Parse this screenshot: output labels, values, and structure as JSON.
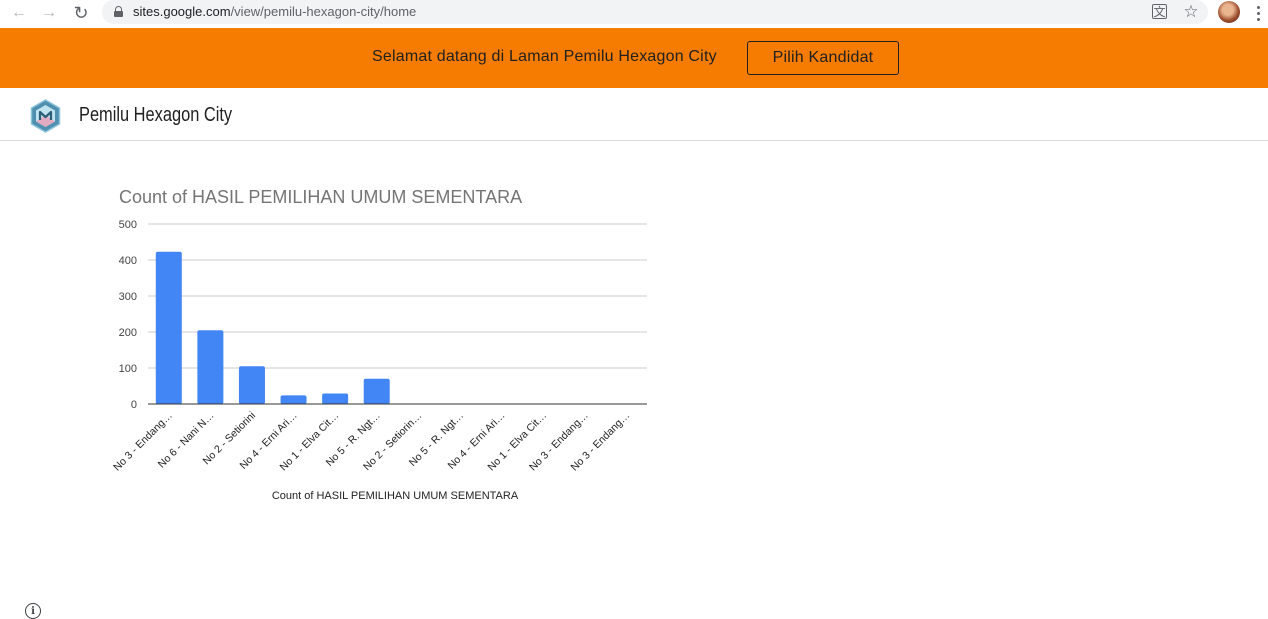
{
  "browser": {
    "url_host": "sites.google.com",
    "url_path": "/view/pemilu-hexagon-city/home",
    "back_icon": "←",
    "forward_icon": "→",
    "reload_icon": "↻",
    "translate_icon": "文",
    "star_icon": "☆"
  },
  "banner": {
    "text": "Selamat datang di Laman Pemilu Hexagon City",
    "button_label": "Pilih Kandidat",
    "color": "#f57c00"
  },
  "site": {
    "title": "Pemilu Hexagon City"
  },
  "chart_data": {
    "type": "bar",
    "title": "Count of HASIL PEMILIHAN UMUM SEMENTARA",
    "xlabel": "Count of HASIL PEMILIHAN UMUM SEMENTARA",
    "ylabel": "",
    "ylim": [
      0,
      500
    ],
    "yticks": [
      0,
      100,
      200,
      300,
      400,
      500
    ],
    "bar_color": "#4285f4",
    "grid": true,
    "categories": [
      "No 3 - Endang…",
      "No 6 - Nani N…",
      "No 2 - Setiorini",
      "No 4 - Erni Ari…",
      "No 1 - Elva Cit…",
      "No 5 - R. Ngt…",
      "No 2 - Setiorin…",
      "No 5 - R. Ngt…",
      "No 4 - Erni Ari…",
      "No 1 - Elva Cit…",
      "No 3 - Endang…",
      "No 3 - Endang…"
    ],
    "values": [
      423,
      205,
      105,
      24,
      29,
      70,
      1,
      1,
      1,
      1,
      1,
      1
    ]
  }
}
